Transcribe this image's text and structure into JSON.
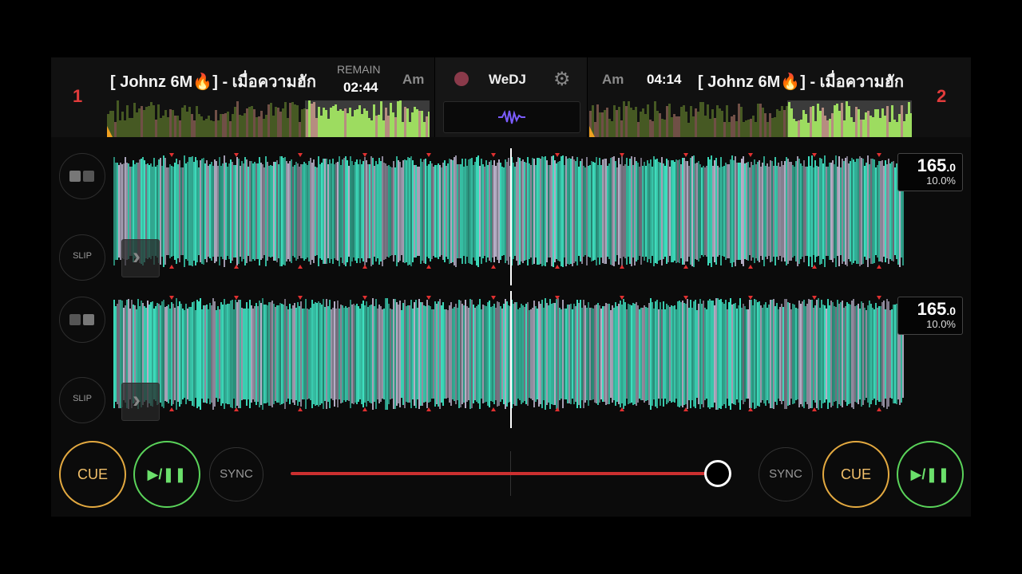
{
  "deck1": {
    "number": "1",
    "title": "[ Johnz 6M🔥] - เมื่อความฮัก",
    "time_label": "REMAIN",
    "time": "02:44",
    "key": "Am",
    "bpm_int": "165",
    "bpm_dec": ".0",
    "pitch": "10.0%",
    "slip_label": "SLIP",
    "cue_label": "CUE",
    "play_label": "▶/❚❚",
    "sync_label": "SYNC"
  },
  "deck2": {
    "number": "2",
    "title": "[ Johnz 6M🔥] - เมื่อความฮัก",
    "time": "04:14",
    "key": "Am",
    "bpm_int": "165",
    "bpm_dec": ".0",
    "pitch": "10.0%",
    "slip_label": "SLIP",
    "cue_label": "CUE",
    "play_label": "▶/❚❚",
    "sync_label": "SYNC"
  },
  "center": {
    "brand": "WeDJ",
    "gear_icon": "gear-icon",
    "record_icon": "record-icon",
    "waveform_icon": "waveform-icon"
  },
  "crossfader": {
    "position": 0.97
  },
  "colors": {
    "deck_number": "#e23b3b",
    "cue": "#e3a940",
    "play": "#5ad35a",
    "waveform_main": "#3fe0c0",
    "waveform_alt": "#b8b0c8",
    "crossfader_track": "#cc3030",
    "beat_marker": "#e03030"
  }
}
